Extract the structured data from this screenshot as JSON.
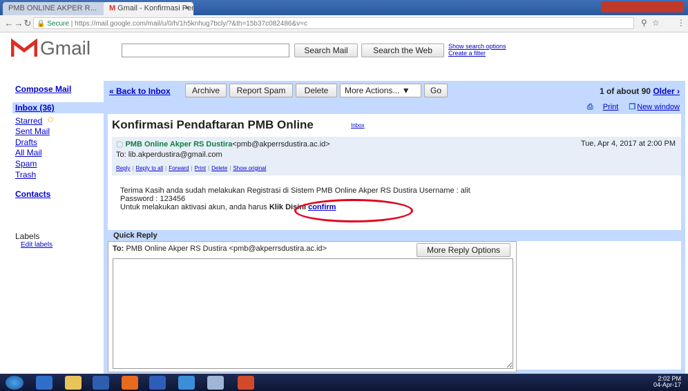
{
  "browser": {
    "tabs": [
      {
        "label": "PMB ONLINE AKPER R..."
      },
      {
        "label": "Gmail - Konfirmasi Pen..."
      }
    ],
    "url": "https://mail.google.com/mail/u/0/h/1h5knhug7bcly/?&th=15b37c082486&v=c",
    "secure_label": "Secure"
  },
  "gmail": {
    "logo_text": "Gmail",
    "search_mail_label": "Search Mail",
    "search_web_label": "Search the Web",
    "show_search_options": "Show search options",
    "create_filter": "Create a filter"
  },
  "nav": {
    "compose": "Compose Mail",
    "inbox": "Inbox (36)",
    "starred": "Starred",
    "sent": "Sent Mail",
    "drafts": "Drafts",
    "all_mail": "All Mail",
    "spam": "Spam",
    "trash": "Trash",
    "contacts": "Contacts",
    "labels": "Labels",
    "edit_labels": "Edit labels"
  },
  "toolbar": {
    "back": "« Back to Inbox",
    "archive": "Archive",
    "report_spam": "Report Spam",
    "delete": "Delete",
    "more_actions": "More Actions... ▼",
    "go": "Go",
    "pager_prefix": "1 of about 90",
    "older": "Older ›",
    "print": "Print",
    "new_window": "New window"
  },
  "message": {
    "subject": "Konfirmasi Pendaftaran PMB Online",
    "subject_label": "Inbox",
    "sender_name": "PMB Online Akper RS Dustira",
    "sender_email": "<pmb@akperrsdustira.ac.id>",
    "date": "Tue, Apr 4, 2017 at 2:00 PM",
    "to": "To: lib.akperdustira@gmail.com",
    "actions": [
      "Reply",
      "Reply to all",
      "Forward",
      "Print",
      "Delete",
      "Show original"
    ],
    "body_line1": "Terima Kasih anda sudah melakukan Registrasi di Sistem PMB Online Akper RS Dustira Username : alit",
    "body_line2": "Password : 123456",
    "body_line3": "Untuk melakukan aktivasi akun, anda harus ",
    "klik_disini": "Klik Disini",
    "confirm_link": "confirm"
  },
  "quick_reply": {
    "title": "Quick Reply",
    "to_label": "To:",
    "to_value": "PMB Online Akper RS Dustira <pmb@akperrsdustira.ac.id>",
    "more_options": "More Reply Options"
  },
  "taskbar": {
    "time": "2:02 PM",
    "date": "04-Apr-17"
  },
  "colors": {
    "accent": "#c3d9ff",
    "highlight_circle": "#e3001b"
  }
}
